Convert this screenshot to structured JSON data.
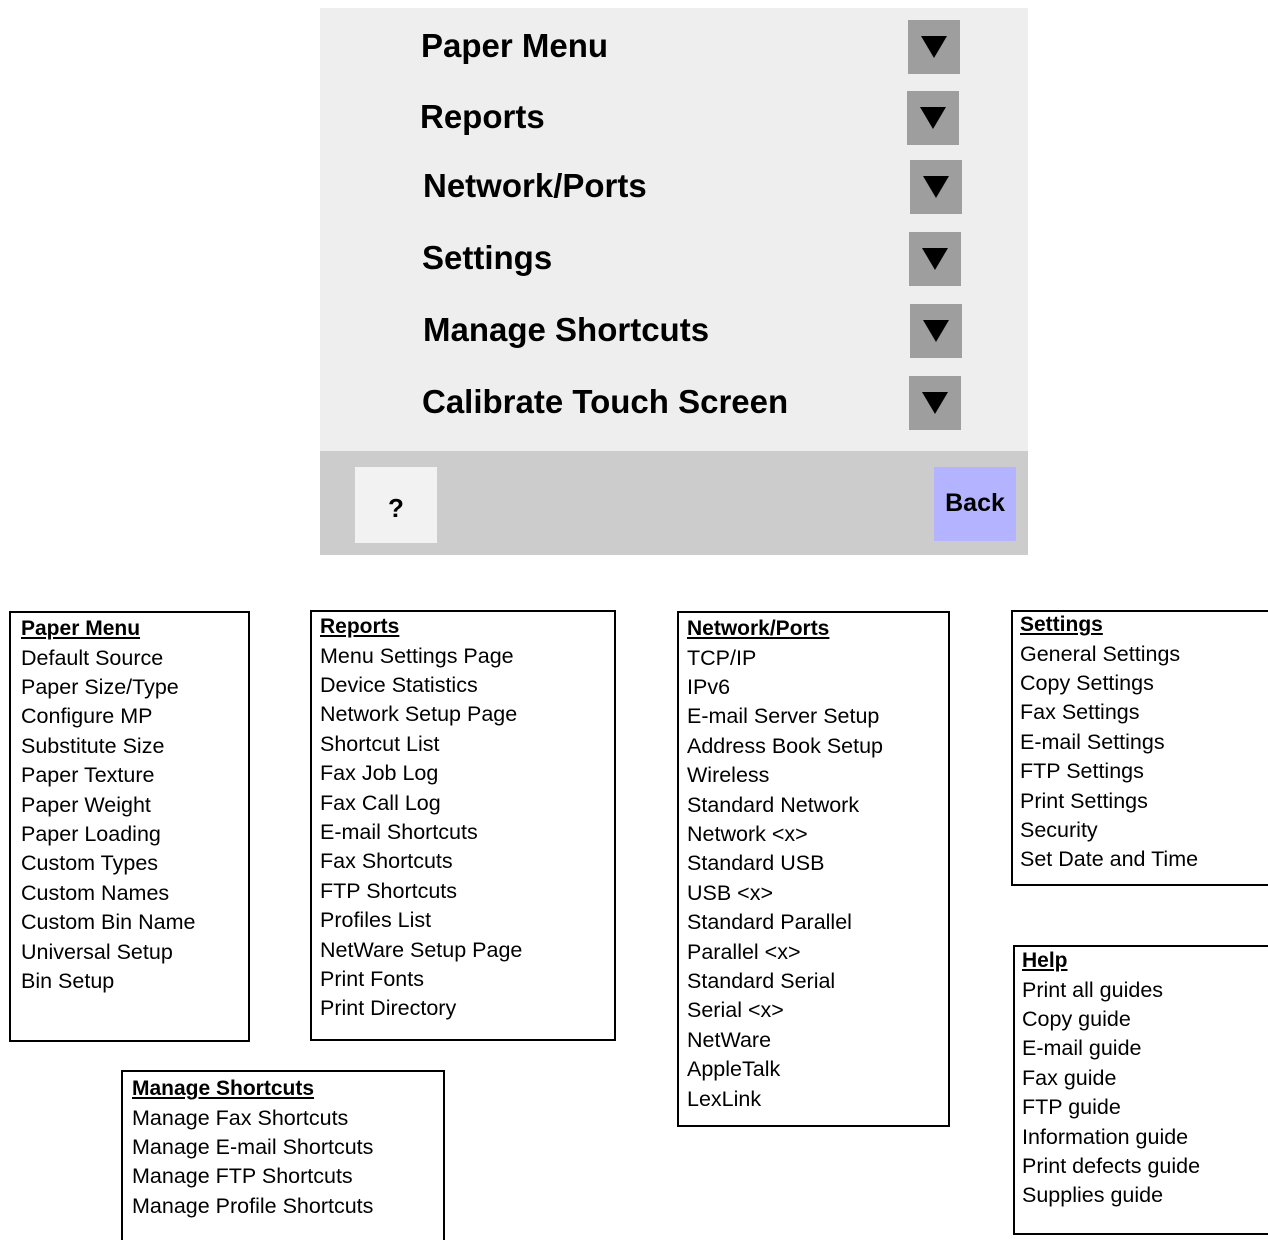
{
  "panel": {
    "menu": [
      {
        "label": "Paper Menu"
      },
      {
        "label": "Reports"
      },
      {
        "label": "Network/Ports"
      },
      {
        "label": "Settings"
      },
      {
        "label": "Manage Shortcuts"
      },
      {
        "label": "Calibrate Touch Screen"
      }
    ],
    "help_label": "?",
    "back_label": "Back"
  },
  "colors": {
    "panel_bg": "#eeeeee",
    "arrow_button": "#9e9e9e",
    "bottom_bar": "#cccccc",
    "back_button": "#b3b3ff"
  },
  "submenus": {
    "paper_menu": {
      "title": "Paper Menu",
      "items": [
        "Default Source",
        "Paper Size/Type",
        "Configure MP",
        "Substitute Size",
        "Paper Texture",
        "Paper Weight",
        "Paper Loading",
        "Custom Types",
        "Custom Names",
        "Custom Bin Name",
        "Universal Setup",
        "Bin Setup"
      ]
    },
    "reports": {
      "title": "Reports",
      "items": [
        "Menu Settings Page",
        "Device Statistics",
        "Network Setup Page",
        "Shortcut List",
        "Fax Job Log",
        "Fax Call Log",
        "E-mail Shortcuts",
        "Fax Shortcuts",
        "FTP Shortcuts",
        "Profiles List",
        "NetWare Setup Page",
        "Print Fonts",
        "Print Directory"
      ]
    },
    "network_ports": {
      "title": "Network/Ports",
      "items": [
        "TCP/IP",
        "IPv6",
        "E-mail Server Setup",
        "Address Book Setup",
        "Wireless",
        "Standard Network",
        "Network <x>",
        "Standard USB",
        "USB <x>",
        "Standard Parallel",
        "Parallel <x>",
        "Standard Serial",
        "Serial <x>",
        "NetWare",
        "AppleTalk",
        "LexLink"
      ]
    },
    "settings": {
      "title": "Settings",
      "items": [
        "General Settings",
        "Copy Settings",
        "Fax Settings",
        "E-mail Settings",
        "FTP Settings",
        "Print Settings",
        "Security",
        "Set Date and Time"
      ]
    },
    "help": {
      "title": "Help",
      "items": [
        "Print all guides",
        "Copy guide",
        "E-mail guide",
        "Fax guide",
        "FTP guide",
        "Information guide",
        "Print defects guide",
        "Supplies guide"
      ]
    },
    "manage_shortcuts": {
      "title": "Manage Shortcuts",
      "items": [
        "Manage Fax Shortcuts",
        "Manage E-mail Shortcuts",
        "Manage FTP Shortcuts",
        "Manage Profile Shortcuts"
      ]
    }
  }
}
